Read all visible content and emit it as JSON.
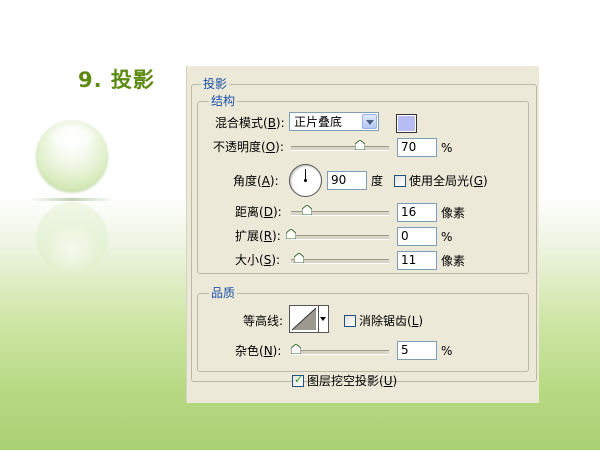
{
  "slide": {
    "title": "9. 投影"
  },
  "dialog": {
    "section_title": "投影",
    "structure": {
      "title": "结构",
      "blend_mode": {
        "label": "混合模式(",
        "key": "B",
        "suffix": "):",
        "value": "正片叠底",
        "color": "#b8bcf5"
      },
      "opacity": {
        "label": "不透明度(",
        "key": "O",
        "suffix": "):",
        "value": "70",
        "unit": "%",
        "fraction": 0.7
      },
      "angle": {
        "label": "角度(",
        "key": "A",
        "suffix": "):",
        "value": "90",
        "unit": "度"
      },
      "global_light": {
        "label": "使用全局光(",
        "key": "G",
        "suffix": ")",
        "checked": false
      },
      "distance": {
        "label": "距离(",
        "key": "D",
        "suffix": "):",
        "value": "16",
        "unit": "像素",
        "fraction": 0.16
      },
      "spread": {
        "label": "扩展(",
        "key": "R",
        "suffix": "):",
        "value": "0",
        "unit": "%",
        "fraction": 0
      },
      "size": {
        "label": "大小(",
        "key": "S",
        "suffix": "):",
        "value": "11",
        "unit": "像素",
        "fraction": 0.08
      }
    },
    "quality": {
      "title": "品质",
      "contour": {
        "label": "等高线:"
      },
      "anti_alias": {
        "label": "消除锯齿(",
        "key": "L",
        "suffix": ")",
        "checked": false
      },
      "noise": {
        "label": "杂色(",
        "key": "N",
        "suffix": "):",
        "value": "5",
        "unit": "%",
        "fraction": 0.05
      }
    },
    "layer_knockout": {
      "label": "图层挖空投影(",
      "key": "U",
      "suffix": ")",
      "checked": true
    }
  }
}
